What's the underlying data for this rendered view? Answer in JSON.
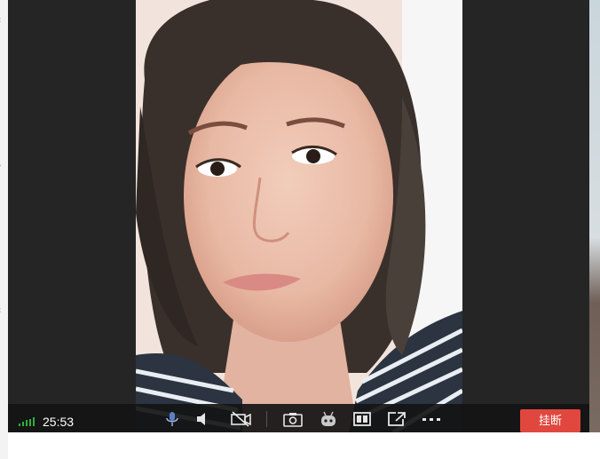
{
  "call": {
    "timer": "25:53",
    "hangup_label": "挂断"
  },
  "controls": [
    {
      "name": "microphone",
      "icon": "microphone-icon"
    },
    {
      "name": "speaker",
      "icon": "speaker-icon"
    },
    {
      "name": "camera-toggle",
      "icon": "video-off-icon"
    },
    {
      "name": "snapshot",
      "icon": "camera-icon"
    },
    {
      "name": "beauty-filter",
      "icon": "robot-face-icon"
    },
    {
      "name": "layout",
      "icon": "split-view-icon"
    },
    {
      "name": "popout",
      "icon": "external-window-icon"
    },
    {
      "name": "more",
      "icon": "more-icon"
    }
  ],
  "colors": {
    "signal": "#2fb03a",
    "hangup": "#e0473e",
    "bar": "#141414"
  }
}
